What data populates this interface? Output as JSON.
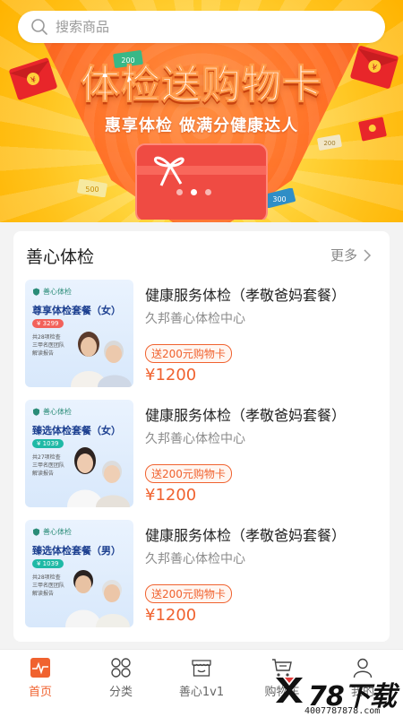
{
  "search": {
    "placeholder": "搜索商品"
  },
  "banner": {
    "title": "体检送购物卡",
    "subtitle": "惠享体检 做满分健康达人",
    "coin_labels": [
      "200",
      "500",
      "300",
      "200"
    ]
  },
  "section": {
    "title": "善心体检",
    "more_label": "更多"
  },
  "items": [
    {
      "title": "健康服务体检（孝敬爸妈套餐）",
      "org": "久邦善心体检中心",
      "tag": "送200元购物卡",
      "price": "¥1200",
      "thumb": {
        "brand": "善心体检",
        "package": "尊享体检套餐（女）",
        "price": "¥ 3299",
        "features": [
          "共28项检查",
          "三甲名医团队",
          "解读报告"
        ]
      }
    },
    {
      "title": "健康服务体检（孝敬爸妈套餐）",
      "org": "久邦善心体检中心",
      "tag": "送200元购物卡",
      "price": "¥1200",
      "thumb": {
        "brand": "善心体检",
        "package": "臻选体检套餐（女）",
        "price": "¥ 1039",
        "features": [
          "共27项检查",
          "三甲名医团队",
          "解读报告"
        ]
      }
    },
    {
      "title": "健康服务体检（孝敬爸妈套餐）",
      "org": "久邦善心体检中心",
      "tag": "送200元购物卡",
      "price": "¥1200",
      "thumb": {
        "brand": "善心体检",
        "package": "臻选体检套餐（男）",
        "price": "¥ 1039",
        "features": [
          "共28项检查",
          "三甲名医团队",
          "解读报告"
        ]
      }
    }
  ],
  "tabs": [
    {
      "label": "首页",
      "icon": "home-pulse-icon",
      "active": true
    },
    {
      "label": "分类",
      "icon": "grid-icon",
      "active": false
    },
    {
      "label": "善心1v1",
      "icon": "shop-icon",
      "active": false
    },
    {
      "label": "购物车",
      "icon": "cart-icon",
      "active": false
    },
    {
      "label": "我的",
      "icon": "user-icon",
      "active": false
    }
  ],
  "watermark": {
    "brand": "78下载",
    "site": "4007787878.com"
  },
  "colors": {
    "accent": "#f0622f",
    "banner_yellow": "#ffc21a",
    "banner_orange": "#ff6b25"
  }
}
